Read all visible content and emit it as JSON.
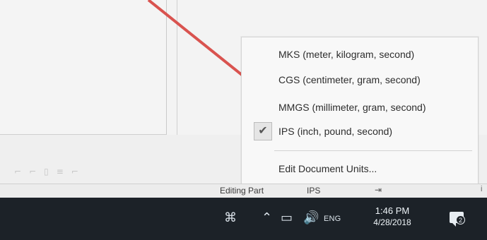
{
  "menu": {
    "items": [
      {
        "label": "MKS (meter, kilogram, second)"
      },
      {
        "label": "CGS (centimeter, gram, second)"
      },
      {
        "label": "MMGS (millimeter, gram, second)"
      },
      {
        "label": "IPS (inch, pound, second)",
        "checked": true
      },
      {
        "label": "Edit Document Units..."
      }
    ]
  },
  "status": {
    "editing": "Editing Part",
    "units": "IPS",
    "info": "i",
    "arrow_icon": "dropdown-arrow-icon"
  },
  "taskbar": {
    "language": "ENG",
    "time": "1:46 PM",
    "date": "4/28/2018",
    "notification_count": "2",
    "icons": {
      "people": "people-icon",
      "chevron": "chevron-up-icon",
      "network": "network-icon",
      "volume": "volume-icon",
      "action_center": "action-center-icon"
    }
  },
  "colors": {
    "accent": "#d9534f",
    "taskbar": "#1c2228"
  }
}
